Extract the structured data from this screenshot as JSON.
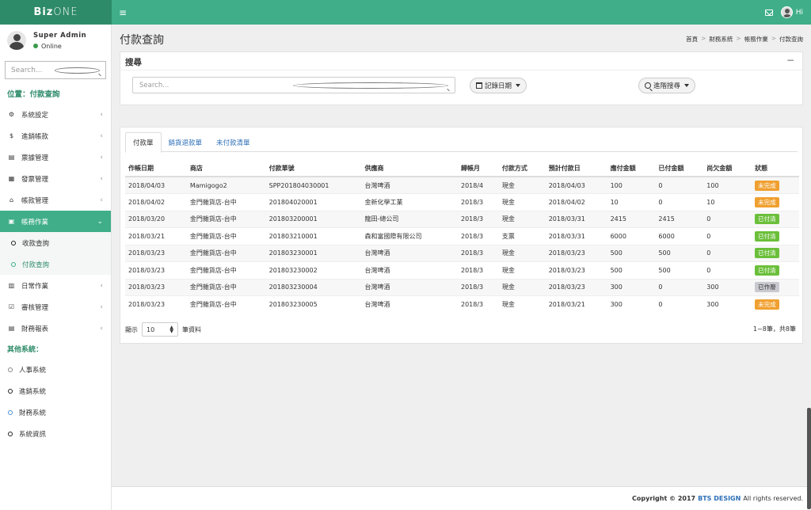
{
  "app": {
    "logo_bold": "Biz",
    "logo_light": "ONE",
    "hamburger": "≡",
    "hi": "Hi"
  },
  "colors": {
    "brand": "#3fae89",
    "brand_dark": "#2e8b6a",
    "link": "#2c6fb7",
    "warning": "#f0a030",
    "success": "#6bbf3a",
    "void": "#c9c9d0"
  },
  "user": {
    "name": "Super Admin",
    "status": "Online"
  },
  "sidebar": {
    "search_placeholder": "Search...",
    "location": "位置：付款查詢",
    "items": [
      {
        "label": "系統設定",
        "icon": "gears-icon"
      },
      {
        "label": "進銷帳款",
        "icon": "dollar-icon"
      },
      {
        "label": "票據管理",
        "icon": "document-icon"
      },
      {
        "label": "發票管理",
        "icon": "invoice-icon"
      },
      {
        "label": "帳款管理",
        "icon": "bank-icon"
      },
      {
        "label": "帳務作業",
        "icon": "briefcase-icon"
      },
      {
        "label": "日常作業",
        "icon": "calendar-icon"
      },
      {
        "label": "審核管理",
        "icon": "check-icon"
      },
      {
        "label": "財務報表",
        "icon": "report-icon"
      }
    ],
    "subitems": [
      "收款查詢",
      "付款查詢"
    ],
    "other_title": "其他系統：",
    "others": [
      "人事系統",
      "進銷系統",
      "財務系統",
      "系統資訊"
    ]
  },
  "page": {
    "title": "付款查詢"
  },
  "breadcrumb": [
    "首頁",
    "財務系統",
    "帳務作業",
    "付款查詢"
  ],
  "search_box": {
    "title": "搜尋",
    "collapse": "−",
    "placeholder": "Search...",
    "date_button": "記錄日期",
    "advanced_button": "進階搜尋"
  },
  "tabs": [
    "付款單",
    "銷貨退款單",
    "未付款清單"
  ],
  "table": {
    "headers": [
      "作帳日期",
      "商店",
      "付款單號",
      "供應商",
      "歸帳月",
      "付款方式",
      "預計付款日",
      "應付金額",
      "已付金額",
      "尚欠金額",
      "狀態"
    ],
    "rows": [
      [
        "2018/04/03",
        "Mamigogo2",
        "SPP201804030001",
        "台灣啤酒",
        "2018/4",
        "現金",
        "2018/04/03",
        "100",
        "0",
        "100",
        "未完成"
      ],
      [
        "2018/04/02",
        "金門雜貨店-台中",
        "201804020001",
        "金新化學工業",
        "2018/3",
        "現金",
        "2018/04/02",
        "10",
        "0",
        "10",
        "未完成"
      ],
      [
        "2018/03/20",
        "金門雜貨店-台中",
        "201803200001",
        "龍田-總公司",
        "2018/3",
        "現金",
        "2018/03/31",
        "2415",
        "2415",
        "0",
        "已付清"
      ],
      [
        "2018/03/21",
        "金門雜貨店-台中",
        "201803210001",
        "森和富國際有限公司",
        "2018/3",
        "支票",
        "2018/03/31",
        "6000",
        "6000",
        "0",
        "已付清"
      ],
      [
        "2018/03/23",
        "金門雜貨店-台中",
        "201803230001",
        "台灣啤酒",
        "2018/3",
        "現金",
        "2018/03/23",
        "500",
        "500",
        "0",
        "已付清"
      ],
      [
        "2018/03/23",
        "金門雜貨店-台中",
        "201803230002",
        "台灣啤酒",
        "2018/3",
        "現金",
        "2018/03/23",
        "500",
        "500",
        "0",
        "已付清"
      ],
      [
        "2018/03/23",
        "金門雜貨店-台中",
        "201803230004",
        "台灣啤酒",
        "2018/3",
        "現金",
        "2018/03/23",
        "300",
        "0",
        "300",
        "已作廢"
      ],
      [
        "2018/03/23",
        "金門雜貨店-台中",
        "201803230005",
        "台灣啤酒",
        "2018/3",
        "現金",
        "2018/03/21",
        "300",
        "0",
        "300",
        "未完成"
      ]
    ]
  },
  "pagination": {
    "show": "顯示",
    "page_size": "10",
    "records": "筆資料",
    "summary": "1~8筆，共8筆"
  },
  "footer": {
    "copyright": "Copyright © 2017",
    "brand": "BTS DESIGN",
    "rights": "All rights reserved."
  }
}
